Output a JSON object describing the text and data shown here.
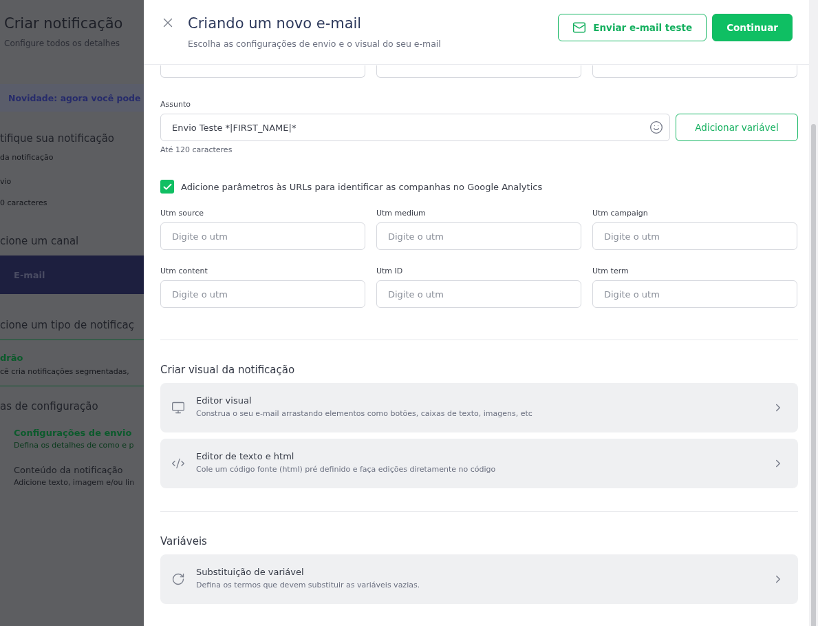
{
  "background": {
    "title": "Criar notificação",
    "subtitle": "Configure todos os detalhes",
    "banner": "Novidade: agora você pode",
    "identify": {
      "title": "tifique sua notificação",
      "label": "da notificação",
      "value": "vio",
      "hint": "0 caracteres"
    },
    "channel": {
      "title": "cione um canal",
      "options": [
        {
          "label": "E-mail",
          "selected": true
        }
      ]
    },
    "type": {
      "title": "cione um tipo de notificaç",
      "options": [
        {
          "title": "drão",
          "description": "cê cria notificações segmentadas,",
          "selected": true
        }
      ]
    },
    "steps": {
      "title": "as de configuração",
      "items": [
        {
          "title": "Configurações de envio",
          "description": "Defina os detalhes de como e p",
          "selected": true
        },
        {
          "title": "Conteúdo da notificação",
          "description": "Adicione texto, imagem e/ou lin",
          "selected": false
        }
      ]
    }
  },
  "drawer": {
    "title": "Criando um novo e-mail",
    "subtitle": "Escolha as configurações de envio e o visual do seu e-mail",
    "buttons": [
      {
        "label": "Enviar e-mail teste",
        "kind": "outline"
      },
      {
        "label": "Continuar",
        "kind": "primary"
      }
    ]
  },
  "subject": {
    "label": "Assunto",
    "value": "Envio Teste *|FIRST_NAME|*",
    "hint": "Até 120 caracteres",
    "button": "Adicionar variável"
  },
  "utm_checkbox": {
    "label": "Adicione parâmetros às URLs para identificar as companhas no Google Analytics",
    "checked": true
  },
  "utm_fields": [
    {
      "label": "Utm source",
      "placeholder": "Digite o utm"
    },
    {
      "label": "Utm medium",
      "placeholder": "Digite o utm"
    },
    {
      "label": "Utm campaign",
      "placeholder": "Digite o utm"
    },
    {
      "label": "Utm content",
      "placeholder": "Digite o utm"
    },
    {
      "label": "Utm ID",
      "placeholder": "Digite o utm"
    },
    {
      "label": "Utm term",
      "placeholder": "Digite o utm"
    }
  ],
  "sections": [
    {
      "title": "Criar visual da notificação",
      "options": [
        {
          "kind": "monitor",
          "title": "Editor visual",
          "description": "Construa o seu e-mail arrastando elementos como botões, caixas de texto, imagens, etc"
        },
        {
          "kind": "code",
          "title": "Editor de texto e html",
          "description": "Cole um código fonte (html) pré definido e faça edições diretamente no código"
        }
      ]
    },
    {
      "title": "Variáveis",
      "options": [
        {
          "kind": "refresh",
          "title": "Substituição de variável",
          "description": "Defina os termos que devem substituir as variáveis vazias."
        }
      ]
    }
  ]
}
